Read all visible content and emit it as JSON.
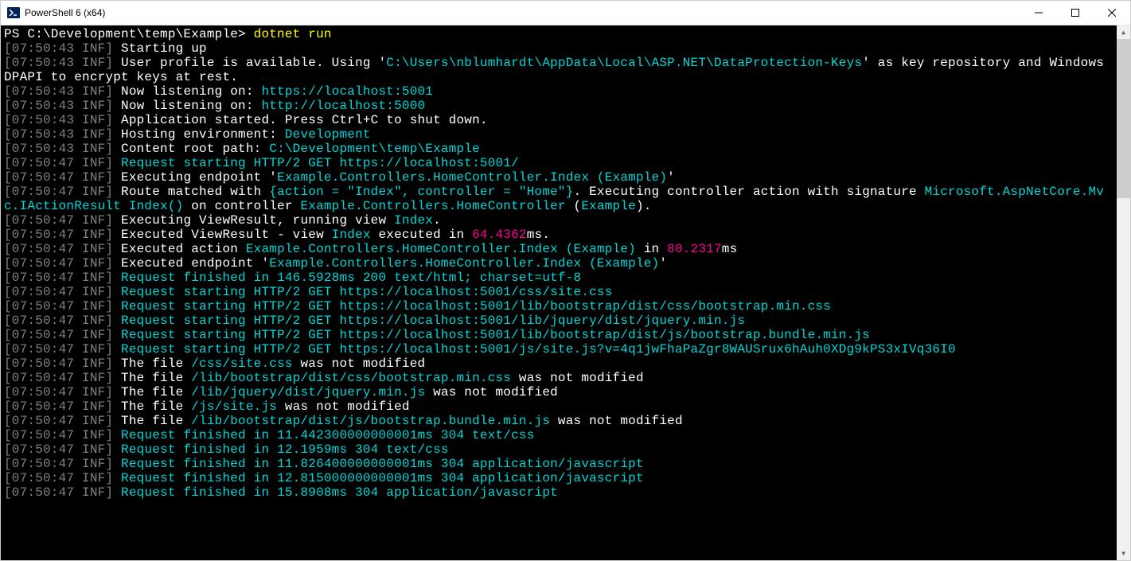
{
  "window": {
    "title": "PowerShell 6 (x64)",
    "minimize_tip": "Minimize",
    "maximize_tip": "Maximize",
    "close_tip": "Close"
  },
  "prompt": {
    "path": "PS C:\\Development\\temp\\Example> ",
    "command": "dotnet run"
  },
  "lines": [
    {
      "ts": "[07:50:43 INF]",
      "segs": [
        {
          "c": "white",
          "t": " Starting up"
        }
      ]
    },
    {
      "ts": "[07:50:43 INF]",
      "segs": [
        {
          "c": "white",
          "t": " User profile is available. Using '"
        },
        {
          "c": "cyan",
          "t": "C:\\Users\\nblumhardt\\AppData\\Local\\ASP.NET\\DataProtection-Keys"
        },
        {
          "c": "white",
          "t": "' as key repository and Windows DPAPI to encrypt keys at rest."
        }
      ]
    },
    {
      "ts": "[07:50:43 INF]",
      "segs": [
        {
          "c": "white",
          "t": " Now listening on: "
        },
        {
          "c": "cyan",
          "t": "https://localhost:5001"
        }
      ]
    },
    {
      "ts": "[07:50:43 INF]",
      "segs": [
        {
          "c": "white",
          "t": " Now listening on: "
        },
        {
          "c": "cyan",
          "t": "http://localhost:5000"
        }
      ]
    },
    {
      "ts": "[07:50:43 INF]",
      "segs": [
        {
          "c": "white",
          "t": " Application started. Press Ctrl+C to shut down."
        }
      ]
    },
    {
      "ts": "[07:50:43 INF]",
      "segs": [
        {
          "c": "white",
          "t": " Hosting environment: "
        },
        {
          "c": "cyan",
          "t": "Development"
        }
      ]
    },
    {
      "ts": "[07:50:43 INF]",
      "segs": [
        {
          "c": "white",
          "t": " Content root path: "
        },
        {
          "c": "cyan",
          "t": "C:\\Development\\temp\\Example"
        }
      ]
    },
    {
      "ts": "[07:50:47 INF]",
      "segs": [
        {
          "c": "cyan",
          "t": " Request starting HTTP/2 GET https://localhost:5001/"
        }
      ]
    },
    {
      "ts": "[07:50:47 INF]",
      "segs": [
        {
          "c": "white",
          "t": " Executing endpoint '"
        },
        {
          "c": "cyan",
          "t": "Example.Controllers.HomeController.Index (Example)"
        },
        {
          "c": "white",
          "t": "'"
        }
      ]
    },
    {
      "ts": "[07:50:47 INF]",
      "segs": [
        {
          "c": "white",
          "t": " Route matched with "
        },
        {
          "c": "cyan",
          "t": "{action = \"Index\", controller = \"Home\"}"
        },
        {
          "c": "white",
          "t": ". Executing controller action with signature "
        },
        {
          "c": "cyan",
          "t": "Microsoft.AspNetCore.Mvc.IActionResult Index()"
        },
        {
          "c": "white",
          "t": " on controller "
        },
        {
          "c": "cyan",
          "t": "Example.Controllers.HomeController"
        },
        {
          "c": "white",
          "t": " ("
        },
        {
          "c": "cyan",
          "t": "Example"
        },
        {
          "c": "white",
          "t": ")."
        }
      ]
    },
    {
      "ts": "[07:50:47 INF]",
      "segs": [
        {
          "c": "white",
          "t": " Executing ViewResult, running view "
        },
        {
          "c": "cyan",
          "t": "Index"
        },
        {
          "c": "white",
          "t": "."
        }
      ]
    },
    {
      "ts": "[07:50:47 INF]",
      "segs": [
        {
          "c": "white",
          "t": " Executed ViewResult - view "
        },
        {
          "c": "cyan",
          "t": "Index"
        },
        {
          "c": "white",
          "t": " executed in "
        },
        {
          "c": "magenta",
          "t": "64.4362"
        },
        {
          "c": "white",
          "t": "ms."
        }
      ]
    },
    {
      "ts": "[07:50:47 INF]",
      "segs": [
        {
          "c": "white",
          "t": " Executed action "
        },
        {
          "c": "cyan",
          "t": "Example.Controllers.HomeController.Index (Example)"
        },
        {
          "c": "white",
          "t": " in "
        },
        {
          "c": "magenta",
          "t": "80.2317"
        },
        {
          "c": "white",
          "t": "ms"
        }
      ]
    },
    {
      "ts": "[07:50:47 INF]",
      "segs": [
        {
          "c": "white",
          "t": " Executed endpoint '"
        },
        {
          "c": "cyan",
          "t": "Example.Controllers.HomeController.Index (Example)"
        },
        {
          "c": "white",
          "t": "'"
        }
      ]
    },
    {
      "ts": "[07:50:47 INF]",
      "segs": [
        {
          "c": "cyan",
          "t": " Request finished in 146.5928ms 200 text/html; charset=utf-8"
        }
      ]
    },
    {
      "ts": "[07:50:47 INF]",
      "segs": [
        {
          "c": "cyan",
          "t": " Request starting HTTP/2 GET https://localhost:5001/css/site.css"
        }
      ]
    },
    {
      "ts": "[07:50:47 INF]",
      "segs": [
        {
          "c": "cyan",
          "t": " Request starting HTTP/2 GET https://localhost:5001/lib/bootstrap/dist/css/bootstrap.min.css"
        }
      ]
    },
    {
      "ts": "[07:50:47 INF]",
      "segs": [
        {
          "c": "cyan",
          "t": " Request starting HTTP/2 GET https://localhost:5001/lib/jquery/dist/jquery.min.js"
        }
      ]
    },
    {
      "ts": "[07:50:47 INF]",
      "segs": [
        {
          "c": "cyan",
          "t": " Request starting HTTP/2 GET https://localhost:5001/lib/bootstrap/dist/js/bootstrap.bundle.min.js"
        }
      ]
    },
    {
      "ts": "[07:50:47 INF]",
      "segs": [
        {
          "c": "cyan",
          "t": " Request starting HTTP/2 GET https://localhost:5001/js/site.js?v=4q1jwFhaPaZgr8WAUSrux6hAuh0XDg9kPS3xIVq36I0"
        }
      ]
    },
    {
      "ts": "[07:50:47 INF]",
      "segs": [
        {
          "c": "white",
          "t": " The file "
        },
        {
          "c": "cyan",
          "t": "/css/site.css"
        },
        {
          "c": "white",
          "t": " was not modified"
        }
      ]
    },
    {
      "ts": "[07:50:47 INF]",
      "segs": [
        {
          "c": "white",
          "t": " The file "
        },
        {
          "c": "cyan",
          "t": "/lib/bootstrap/dist/css/bootstrap.min.css"
        },
        {
          "c": "white",
          "t": " was not modified"
        }
      ]
    },
    {
      "ts": "[07:50:47 INF]",
      "segs": [
        {
          "c": "white",
          "t": " The file "
        },
        {
          "c": "cyan",
          "t": "/lib/jquery/dist/jquery.min.js"
        },
        {
          "c": "white",
          "t": " was not modified"
        }
      ]
    },
    {
      "ts": "[07:50:47 INF]",
      "segs": [
        {
          "c": "white",
          "t": " The file "
        },
        {
          "c": "cyan",
          "t": "/js/site.js"
        },
        {
          "c": "white",
          "t": " was not modified"
        }
      ]
    },
    {
      "ts": "[07:50:47 INF]",
      "segs": [
        {
          "c": "white",
          "t": " The file "
        },
        {
          "c": "cyan",
          "t": "/lib/bootstrap/dist/js/bootstrap.bundle.min.js"
        },
        {
          "c": "white",
          "t": " was not modified"
        }
      ]
    },
    {
      "ts": "[07:50:47 INF]",
      "segs": [
        {
          "c": "cyan",
          "t": " Request finished in 11.442300000000001ms 304 text/css"
        }
      ]
    },
    {
      "ts": "[07:50:47 INF]",
      "segs": [
        {
          "c": "cyan",
          "t": " Request finished in 12.1959ms 304 text/css"
        }
      ]
    },
    {
      "ts": "[07:50:47 INF]",
      "segs": [
        {
          "c": "cyan",
          "t": " Request finished in 11.826400000000001ms 304 application/javascript"
        }
      ]
    },
    {
      "ts": "[07:50:47 INF]",
      "segs": [
        {
          "c": "cyan",
          "t": " Request finished in 12.815000000000001ms 304 application/javascript"
        }
      ]
    },
    {
      "ts": "[07:50:47 INF]",
      "segs": [
        {
          "c": "cyan",
          "t": " Request finished in 15.8908ms 304 application/javascript"
        }
      ]
    }
  ]
}
